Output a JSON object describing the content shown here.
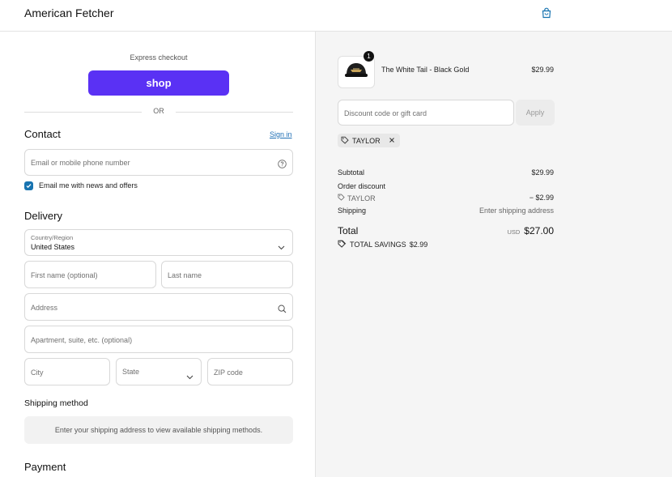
{
  "header": {
    "store_name": "American Fetcher"
  },
  "icons": {
    "bag": "shopping-bag-icon",
    "help": "help-circle-icon",
    "search": "search-icon",
    "chevron": "chevron-down-icon",
    "tag": "tag-icon",
    "close": "close-icon",
    "check": "checkmark-icon"
  },
  "express": {
    "label": "Express checkout",
    "shop_label": "shop",
    "or_label": "OR"
  },
  "contact": {
    "title": "Contact",
    "signin": "Sign in",
    "email_placeholder": "Email or mobile phone number",
    "news_label": "Email me with news and offers",
    "news_checked": true
  },
  "delivery": {
    "title": "Delivery",
    "country_label": "Country/Region",
    "country_value": "United States",
    "first_name_ph": "First name (optional)",
    "last_name_ph": "Last name",
    "address_ph": "Address",
    "apartment_ph": "Apartment, suite, etc. (optional)",
    "city_ph": "City",
    "state_ph": "State",
    "zip_ph": "ZIP code"
  },
  "shipping": {
    "title": "Shipping method",
    "message": "Enter your shipping address to view available shipping methods."
  },
  "payment": {
    "title": "Payment"
  },
  "summary": {
    "product_name": "The White Tail - Black Gold",
    "product_price": "$29.99",
    "quantity": "1",
    "discount_ph": "Discount code or gift card",
    "apply_label": "Apply",
    "code_chip": "TAYLOR",
    "subtotal_label": "Subtotal",
    "subtotal_value": "$29.99",
    "order_discount_label": "Order discount",
    "discount_code": "TAYLOR",
    "discount_value": "− $2.99",
    "shipping_label": "Shipping",
    "shipping_value": "Enter shipping address",
    "total_label": "Total",
    "currency": "USD",
    "total_value": "$27.00",
    "savings_label": "TOTAL SAVINGS",
    "savings_value": "$2.99"
  },
  "colors": {
    "shop": "#5a31f4",
    "link": "#1f6fb5",
    "checkbox": "#1773b0",
    "sidebar_bg": "#f5f5f5"
  }
}
